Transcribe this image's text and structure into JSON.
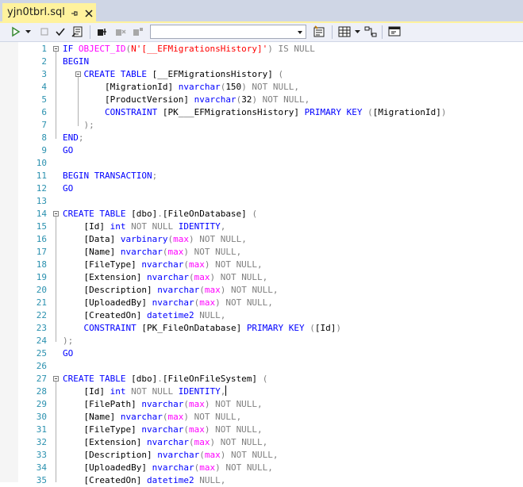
{
  "tab": {
    "title": "yjn0tbrl.sql"
  },
  "toolbar": {
    "database_select_value": ""
  },
  "editor": {
    "lines": [
      {
        "num": "1",
        "tokens": [
          [
            "k",
            "IF "
          ],
          [
            "f",
            "OBJECT_ID"
          ],
          [
            "g",
            "("
          ],
          [
            "s",
            "N'[__EFMigrationsHistory]'"
          ],
          [
            "g",
            ") IS NULL"
          ]
        ]
      },
      {
        "num": "2",
        "tokens": [
          [
            "k",
            "BEGIN"
          ]
        ]
      },
      {
        "num": "3",
        "tokens": [
          [
            "t",
            "    "
          ],
          [
            "k",
            "CREATE TABLE "
          ],
          [
            "t",
            "[__EFMigrationsHistory] "
          ],
          [
            "g",
            "("
          ]
        ]
      },
      {
        "num": "4",
        "tokens": [
          [
            "t",
            "        [MigrationId] "
          ],
          [
            "k",
            "nvarchar"
          ],
          [
            "g",
            "("
          ],
          [
            "t",
            "150"
          ],
          [
            "g",
            ") NOT NULL,"
          ]
        ]
      },
      {
        "num": "5",
        "tokens": [
          [
            "t",
            "        [ProductVersion] "
          ],
          [
            "k",
            "nvarchar"
          ],
          [
            "g",
            "("
          ],
          [
            "t",
            "32"
          ],
          [
            "g",
            ") NOT NULL,"
          ]
        ]
      },
      {
        "num": "6",
        "tokens": [
          [
            "t",
            "        "
          ],
          [
            "k",
            "CONSTRAINT "
          ],
          [
            "t",
            "[PK___EFMigrationsHistory] "
          ],
          [
            "k",
            "PRIMARY KEY "
          ],
          [
            "g",
            "("
          ],
          [
            "t",
            "[MigrationId]"
          ],
          [
            "g",
            ")"
          ]
        ]
      },
      {
        "num": "7",
        "tokens": [
          [
            "t",
            "    "
          ],
          [
            "g",
            ");"
          ]
        ]
      },
      {
        "num": "8",
        "tokens": [
          [
            "k",
            "END"
          ],
          [
            "g",
            ";"
          ]
        ]
      },
      {
        "num": "9",
        "tokens": [
          [
            "k",
            "GO"
          ]
        ]
      },
      {
        "num": "10",
        "tokens": []
      },
      {
        "num": "11",
        "tokens": [
          [
            "k",
            "BEGIN TRANSACTION"
          ],
          [
            "g",
            ";"
          ]
        ]
      },
      {
        "num": "12",
        "tokens": [
          [
            "k",
            "GO"
          ]
        ]
      },
      {
        "num": "13",
        "tokens": []
      },
      {
        "num": "14",
        "tokens": [
          [
            "k",
            "CREATE TABLE "
          ],
          [
            "t",
            "[dbo]"
          ],
          [
            "g",
            "."
          ],
          [
            "t",
            "[FileOnDatabase] "
          ],
          [
            "g",
            "("
          ]
        ]
      },
      {
        "num": "15",
        "tokens": [
          [
            "t",
            "    [Id] "
          ],
          [
            "k",
            "int "
          ],
          [
            "g",
            "NOT NULL "
          ],
          [
            "k",
            "IDENTITY"
          ],
          [
            "g",
            ","
          ]
        ]
      },
      {
        "num": "16",
        "tokens": [
          [
            "t",
            "    [Data] "
          ],
          [
            "k",
            "varbinary"
          ],
          [
            "g",
            "("
          ],
          [
            "f",
            "max"
          ],
          [
            "g",
            ") NOT NULL,"
          ]
        ]
      },
      {
        "num": "17",
        "tokens": [
          [
            "t",
            "    [Name] "
          ],
          [
            "k",
            "nvarchar"
          ],
          [
            "g",
            "("
          ],
          [
            "f",
            "max"
          ],
          [
            "g",
            ") NOT NULL,"
          ]
        ]
      },
      {
        "num": "18",
        "tokens": [
          [
            "t",
            "    [FileType] "
          ],
          [
            "k",
            "nvarchar"
          ],
          [
            "g",
            "("
          ],
          [
            "f",
            "max"
          ],
          [
            "g",
            ") NOT NULL,"
          ]
        ]
      },
      {
        "num": "19",
        "tokens": [
          [
            "t",
            "    [Extension] "
          ],
          [
            "k",
            "nvarchar"
          ],
          [
            "g",
            "("
          ],
          [
            "f",
            "max"
          ],
          [
            "g",
            ") NOT NULL,"
          ]
        ]
      },
      {
        "num": "20",
        "tokens": [
          [
            "t",
            "    [Description] "
          ],
          [
            "k",
            "nvarchar"
          ],
          [
            "g",
            "("
          ],
          [
            "f",
            "max"
          ],
          [
            "g",
            ") NOT NULL,"
          ]
        ]
      },
      {
        "num": "21",
        "tokens": [
          [
            "t",
            "    [UploadedBy] "
          ],
          [
            "k",
            "nvarchar"
          ],
          [
            "g",
            "("
          ],
          [
            "f",
            "max"
          ],
          [
            "g",
            ") NOT NULL,"
          ]
        ]
      },
      {
        "num": "22",
        "tokens": [
          [
            "t",
            "    [CreatedOn] "
          ],
          [
            "k",
            "datetime2 "
          ],
          [
            "g",
            "NULL,"
          ]
        ]
      },
      {
        "num": "23",
        "tokens": [
          [
            "t",
            "    "
          ],
          [
            "k",
            "CONSTRAINT "
          ],
          [
            "t",
            "[PK_FileOnDatabase] "
          ],
          [
            "k",
            "PRIMARY KEY "
          ],
          [
            "g",
            "("
          ],
          [
            "t",
            "[Id]"
          ],
          [
            "g",
            ")"
          ]
        ]
      },
      {
        "num": "24",
        "tokens": [
          [
            "g",
            ");"
          ]
        ]
      },
      {
        "num": "25",
        "tokens": [
          [
            "k",
            "GO"
          ]
        ]
      },
      {
        "num": "26",
        "tokens": []
      },
      {
        "num": "27",
        "tokens": [
          [
            "k",
            "CREATE TABLE "
          ],
          [
            "t",
            "[dbo]"
          ],
          [
            "g",
            "."
          ],
          [
            "t",
            "[FileOnFileSystem] "
          ],
          [
            "g",
            "("
          ]
        ]
      },
      {
        "num": "28",
        "tokens": [
          [
            "t",
            "    [Id] "
          ],
          [
            "k",
            "int "
          ],
          [
            "g",
            "NOT NULL "
          ],
          [
            "k",
            "IDENTITY"
          ],
          [
            "g",
            ","
          ]
        ],
        "caret": true
      },
      {
        "num": "29",
        "tokens": [
          [
            "t",
            "    [FilePath] "
          ],
          [
            "k",
            "nvarchar"
          ],
          [
            "g",
            "("
          ],
          [
            "f",
            "max"
          ],
          [
            "g",
            ") NOT NULL,"
          ]
        ]
      },
      {
        "num": "30",
        "tokens": [
          [
            "t",
            "    [Name] "
          ],
          [
            "k",
            "nvarchar"
          ],
          [
            "g",
            "("
          ],
          [
            "f",
            "max"
          ],
          [
            "g",
            ") NOT NULL,"
          ]
        ]
      },
      {
        "num": "31",
        "tokens": [
          [
            "t",
            "    [FileType] "
          ],
          [
            "k",
            "nvarchar"
          ],
          [
            "g",
            "("
          ],
          [
            "f",
            "max"
          ],
          [
            "g",
            ") NOT NULL,"
          ]
        ]
      },
      {
        "num": "32",
        "tokens": [
          [
            "t",
            "    [Extension] "
          ],
          [
            "k",
            "nvarchar"
          ],
          [
            "g",
            "("
          ],
          [
            "f",
            "max"
          ],
          [
            "g",
            ") NOT NULL,"
          ]
        ]
      },
      {
        "num": "33",
        "tokens": [
          [
            "t",
            "    [Description] "
          ],
          [
            "k",
            "nvarchar"
          ],
          [
            "g",
            "("
          ],
          [
            "f",
            "max"
          ],
          [
            "g",
            ") NOT NULL,"
          ]
        ]
      },
      {
        "num": "34",
        "tokens": [
          [
            "t",
            "    [UploadedBy] "
          ],
          [
            "k",
            "nvarchar"
          ],
          [
            "g",
            "("
          ],
          [
            "f",
            "max"
          ],
          [
            "g",
            ") NOT NULL,"
          ]
        ]
      },
      {
        "num": "35",
        "tokens": [
          [
            "t",
            "    [CreatedOn] "
          ],
          [
            "k",
            "datetime2 "
          ],
          [
            "g",
            "NULL,"
          ]
        ]
      }
    ]
  }
}
